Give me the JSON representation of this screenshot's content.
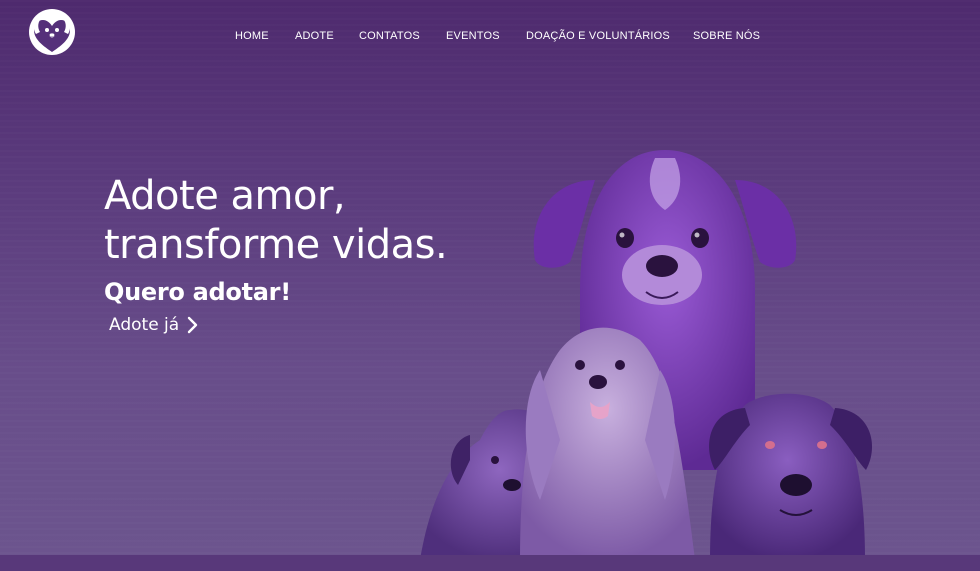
{
  "brand": {
    "logo_icon": "paws-heart-logo-icon"
  },
  "nav": {
    "items": [
      {
        "label": "HOME"
      },
      {
        "label": "ADOTE"
      },
      {
        "label": "CONTATOS"
      },
      {
        "label": "EVENTOS"
      },
      {
        "label": "DOAÇÃO E VOLUNTÁRIOS"
      },
      {
        "label": "SOBRE NÓS"
      }
    ]
  },
  "hero": {
    "title_line1": "Adote amor,",
    "title_line2": "transforme vidas.",
    "subtitle": "Quero adotar!",
    "cta_label": "Adote já",
    "cta_icon": "chevron-right-icon",
    "image": "purple-dogs-illustration"
  },
  "colors": {
    "background": "#5a3a7c",
    "text": "#ffffff",
    "accent": "#7b3fb0"
  }
}
